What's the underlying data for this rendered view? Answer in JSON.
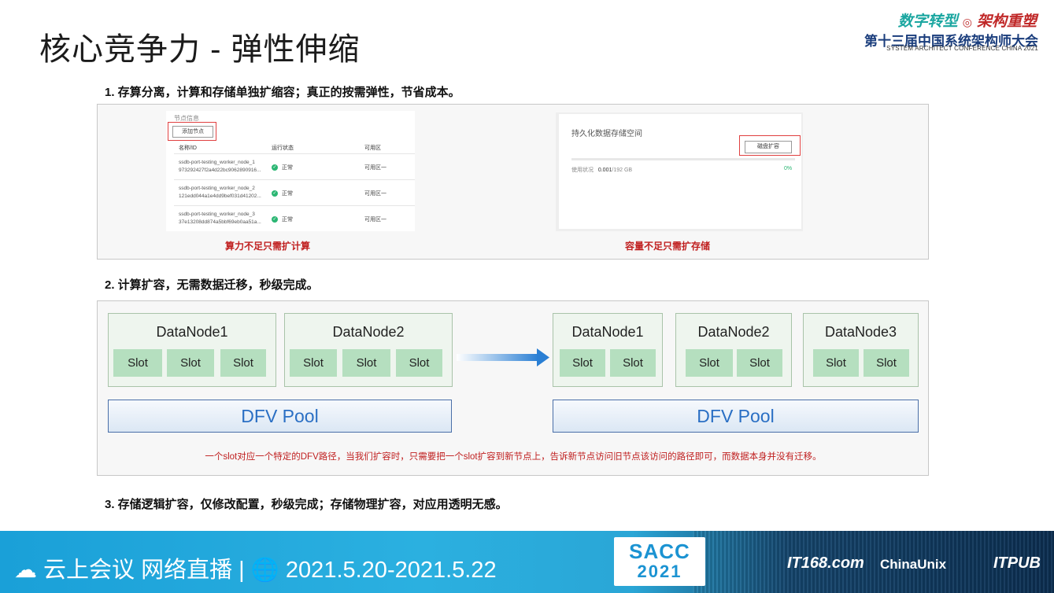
{
  "title": "核心竞争力 - 弹性伸缩",
  "logo": {
    "slogan_left": "数字转型",
    "slogan_sep": "◎",
    "slogan_right": "架构重塑",
    "conference_cn": "第十三届中国系统架构师大会",
    "conference_en": "SYSTEM ARCHITECT CONFERENCE CHINA 2021"
  },
  "section1": {
    "heading": "1. 存算分离，计算和存储单独扩缩容；真正的按需弹性，节省成本。",
    "node_panel": {
      "header": "节点信息",
      "add_button": "添加节点",
      "columns": [
        "名称/ID",
        "运行状态",
        "可用区"
      ],
      "rows": [
        {
          "name": "ssdb-port-testing_worker_node_1",
          "id": "973292427f2a4d22bc9062890916...",
          "status": "正常",
          "zone": "可用区一"
        },
        {
          "name": "ssdb-port-testing_worker_node_2",
          "id": "121edd044a1e4dd9bef031d41202...",
          "status": "正常",
          "zone": "可用区一"
        },
        {
          "name": "ssdb-port-testing_worker_node_3",
          "id": "37e13208dd874a5bbf69eb0aa51a...",
          "status": "正常",
          "zone": "可用区一"
        }
      ]
    },
    "storage_panel": {
      "title": "持久化数据存储空间",
      "expand_button": "磁盘扩容",
      "usage_label": "使用状况",
      "used": "0.001",
      "total": "/192 GB",
      "percent": "0%"
    },
    "caption_left": "算力不足只需扩计算",
    "caption_right": "容量不足只需扩存储"
  },
  "section2": {
    "heading": "2. 计算扩容，无需数据迁移，秒级完成。",
    "before": {
      "nodes": [
        {
          "label": "DataNode1",
          "slots": [
            "Slot",
            "Slot",
            "Slot"
          ]
        },
        {
          "label": "DataNode2",
          "slots": [
            "Slot",
            "Slot",
            "Slot"
          ]
        }
      ],
      "pool": "DFV Pool"
    },
    "after": {
      "nodes": [
        {
          "label": "DataNode1",
          "slots": [
            "Slot",
            "Slot"
          ]
        },
        {
          "label": "DataNode2",
          "slots": [
            "Slot",
            "Slot"
          ]
        },
        {
          "label": "DataNode3",
          "slots": [
            "Slot",
            "Slot"
          ]
        }
      ],
      "pool": "DFV Pool"
    },
    "note": "一个slot对应一个特定的DFV路径，当我们扩容时，只需要把一个slot扩容到新节点上，告诉新节点访问旧节点该访问的路径即可，而数据本身并没有迁移。"
  },
  "section3": {
    "heading": "3. 存储逻辑扩容，仅修改配置，秒级完成；存储物理扩容，对应用透明无感。"
  },
  "footer": {
    "text": "☁ 云上会议 网络直播 | 🌐 2021.5.20-2021.5.22",
    "sacc_top": "SACC",
    "sacc_bottom": "2021",
    "sponsors": [
      "IT168.com",
      "ChinaUnix",
      "ITPUB"
    ]
  },
  "colors": {
    "accent_red": "#c02020",
    "slot_green": "#b5dfbf",
    "pool_blue": "#2a6fc4"
  }
}
